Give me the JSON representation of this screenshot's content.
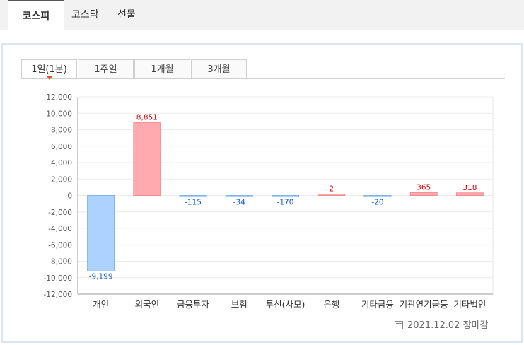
{
  "top_tabs": [
    {
      "label": "코스피",
      "active": true
    },
    {
      "label": "코스닥",
      "active": false
    },
    {
      "label": "선물",
      "active": false
    }
  ],
  "sub_tabs": [
    {
      "label": "1일(1분)",
      "active": true
    },
    {
      "label": "1주일",
      "active": false
    },
    {
      "label": "1개월",
      "active": false
    },
    {
      "label": "3개월",
      "active": false
    }
  ],
  "footer": {
    "date": "2021.12.02",
    "status": "장마감",
    "icon": "calendar-icon"
  },
  "colors": {
    "positive_fill": "#ffaaae",
    "positive_stroke": "#f28a8e",
    "positive_label": "#d20000",
    "negative_fill": "#aed2ff",
    "negative_stroke": "#7fb1ec",
    "negative_label": "#0a56d6",
    "accent": "#e8541c"
  },
  "chart_data": {
    "type": "bar",
    "categories": [
      "개인",
      "외국인",
      "금융투자",
      "보험",
      "투신(사모)",
      "은행",
      "기타금융",
      "기관연기금등",
      "기타법인"
    ],
    "values": [
      -9199,
      8851,
      -115,
      -34,
      -170,
      2,
      -20,
      365,
      318
    ],
    "value_labels": [
      "-9,199",
      "8,851",
      "-115",
      "-34",
      "-170",
      "2",
      "-20",
      "365",
      "318"
    ],
    "ylim": [
      -12000,
      12000
    ],
    "yticks": [
      12000,
      10000,
      8000,
      6000,
      4000,
      2000,
      0,
      -2000,
      -4000,
      -6000,
      -8000,
      -10000,
      -12000
    ],
    "ytick_labels": [
      "12,000",
      "10,000",
      "8,000",
      "6,000",
      "4,000",
      "2,000",
      "0",
      "-2,000",
      "-4,000",
      "-6,000",
      "-8,000",
      "-10,000",
      "-12,000"
    ],
    "grid": true,
    "title": "",
    "xlabel": "",
    "ylabel": ""
  }
}
